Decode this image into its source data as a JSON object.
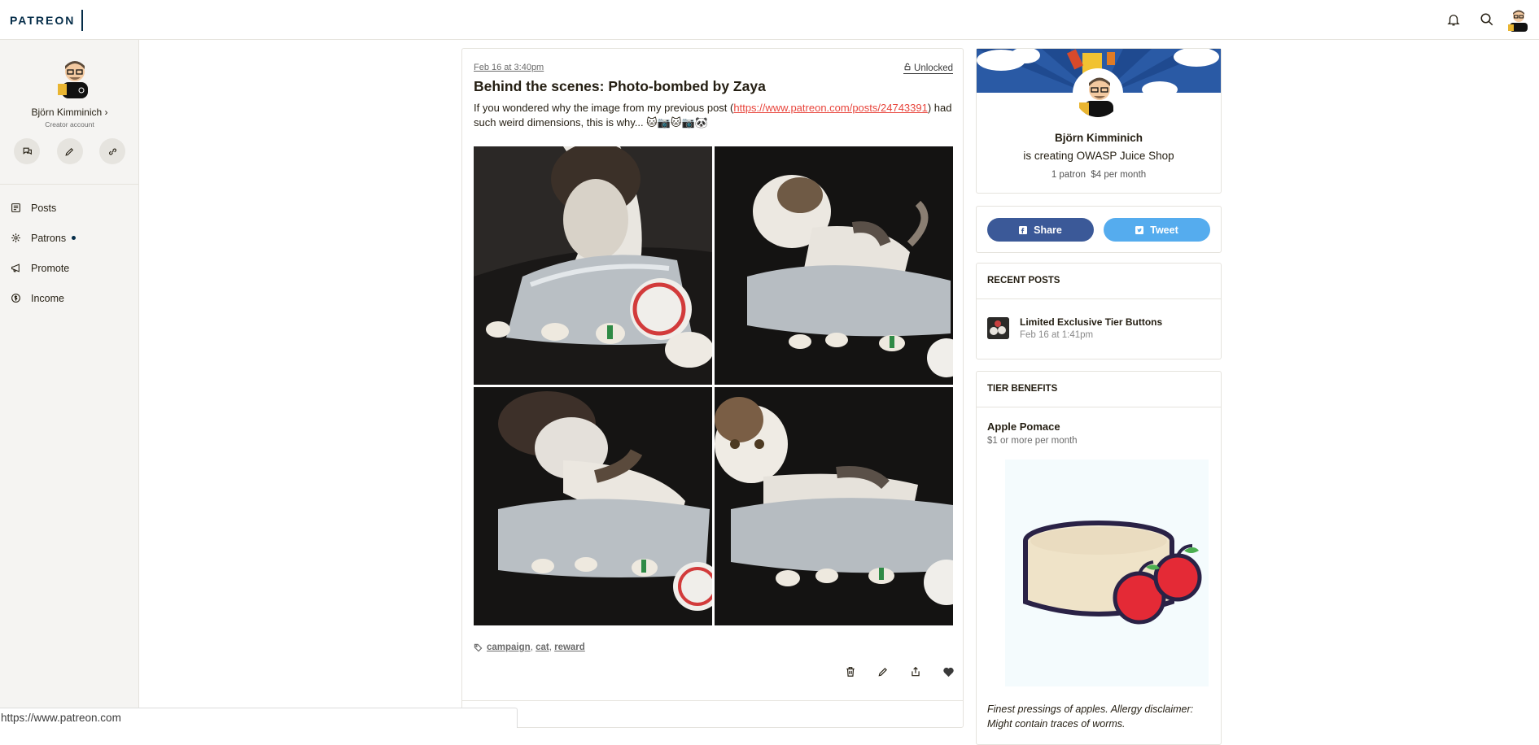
{
  "header": {
    "logo": "PATREON",
    "icons": [
      "bell-icon",
      "search-icon",
      "avatar"
    ]
  },
  "sidebar": {
    "name": "Björn Kimminich ›",
    "subtitle": "Creator account",
    "actions": [
      "chat-icon",
      "pencil-icon",
      "link-icon"
    ],
    "nav": [
      {
        "label": "Posts",
        "icon": "posts-icon"
      },
      {
        "label": "Patrons",
        "icon": "patrons-icon",
        "has_dot": true
      },
      {
        "label": "Promote",
        "icon": "megaphone-icon"
      },
      {
        "label": "Income",
        "icon": "dollar-icon"
      }
    ]
  },
  "post": {
    "date": "Feb 16 at 3:40pm",
    "status": "Unlocked",
    "title": "Behind the scenes: Photo-bombed by Zaya",
    "body_before": "If you wondered why the image from my previous post (",
    "link": "https://www.patreon.com/posts/24743391",
    "body_after": ") had such weird dimensions, this is why... 🐱📷🐱📷🐼",
    "tags_label": "campaign, cat, reward",
    "tags": [
      "campaign",
      "cat",
      "reward"
    ],
    "action_icons": [
      "trash-icon",
      "pencil-icon",
      "share-icon",
      "heart-icon"
    ]
  },
  "creator": {
    "name": "Björn Kimminich",
    "creating": "is creating OWASP Juice Shop",
    "patrons": "1 patron",
    "per_month": "$4 per month"
  },
  "share": {
    "share_label": "Share",
    "tweet_label": "Tweet",
    "share_color": "#3b5998",
    "tweet_color": "#55acee"
  },
  "recent_posts": {
    "heading": "RECENT POSTS",
    "items": [
      {
        "title": "Limited Exclusive Tier Buttons",
        "date": "Feb 16 at 1:41pm"
      }
    ]
  },
  "tier_benefits": {
    "heading": "TIER BENEFITS",
    "tier_name": "Apple Pomace",
    "tier_price": "$1 or more per month",
    "description": "Finest pressings of apples. Allergy disclaimer: Might contain traces of worms."
  },
  "status_bar": {
    "url": "https://www.patreon.com"
  }
}
